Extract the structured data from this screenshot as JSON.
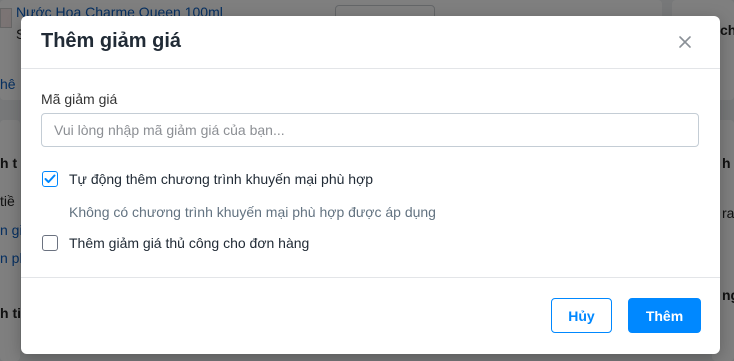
{
  "background": {
    "product_name": "Nước Hoa Charme Queen 100ml",
    "product_sub": "S",
    "left_frag_1": "hê",
    "left_frag_2": "h t",
    "left_frag_3": "tiề",
    "left_frag_4": "n gi",
    "left_frag_5": "n ph",
    "left_frag_6": "h ti",
    "right_frag_1": "ch",
    "right_frag_2": "h tả",
    "right_frag_3": "ra",
    "right_frag_4": "ng"
  },
  "modal": {
    "title": "Thêm giảm giá",
    "close_icon": "close-icon",
    "field_label": "Mã giảm giá",
    "field_placeholder": "Vui lòng nhập mã giảm giá của bạn...",
    "field_value": "",
    "auto_promo_label": "Tự động thêm chương trình khuyến mại phù hợp",
    "auto_promo_checked": true,
    "no_promo_note": "Không có chương trình khuyến mại phù hợp được áp dụng",
    "manual_label": "Thêm giảm giá thủ công cho đơn hàng",
    "manual_checked": false,
    "cancel_label": "Hủy",
    "add_label": "Thêm"
  },
  "colors": {
    "primary": "#0088ff",
    "overlay": "rgba(0,0,0,0.5)",
    "link": "#0a5ec2"
  }
}
